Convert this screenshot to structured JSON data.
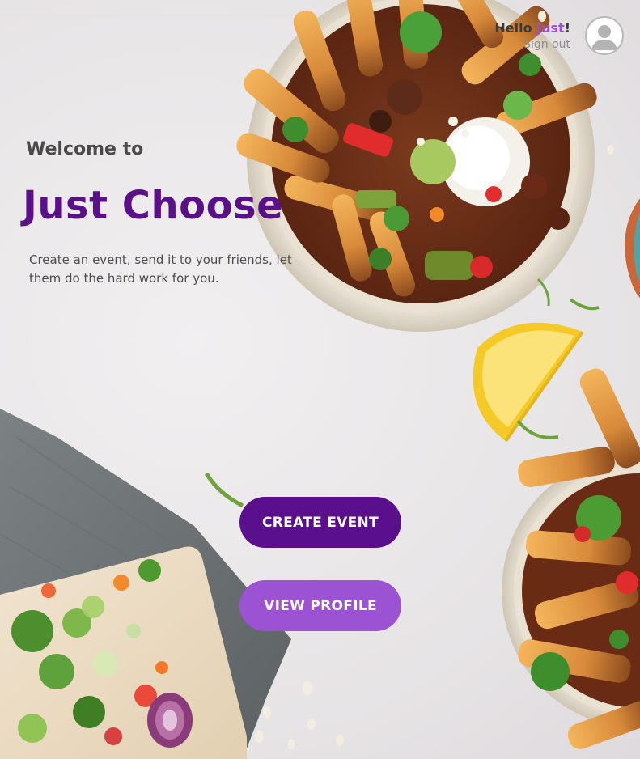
{
  "header": {
    "greeting_prefix": "Hello ",
    "user_name": "Just",
    "greeting_suffix": "!",
    "signout_label": "Sign out",
    "avatar_icon": "user-avatar-icon"
  },
  "hero": {
    "welcome": "Welcome to",
    "app_title": "Just Choose",
    "tagline": "Create an event, send it to your friends, let them do the hard work for you."
  },
  "actions": {
    "create_event_label": "CREATE EVENT",
    "view_profile_label": "VIEW PROFILE"
  },
  "colors": {
    "primary": "#5a0f8c",
    "secondary": "#9b52d3",
    "accent_name": "#9a4fd2"
  }
}
